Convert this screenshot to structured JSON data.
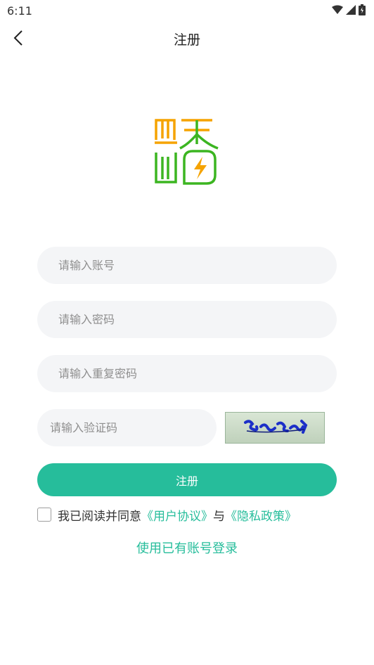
{
  "status_bar": {
    "time": "6:11",
    "icons": [
      "wifi-icon",
      "signal-icon",
      "battery-icon"
    ]
  },
  "header": {
    "title": "注册",
    "back_icon": "chevron-left-icon"
  },
  "logo": {
    "colors": {
      "orange": "#f5a300",
      "green": "#3cb521"
    }
  },
  "form": {
    "account_placeholder": "请输入账号",
    "password_placeholder": "请输入密码",
    "repeat_password_placeholder": "请输入重复密码",
    "code_placeholder": "请输入验证码",
    "submit_label": "注册"
  },
  "agreement": {
    "prefix": "我已阅读并同意",
    "user_agreement": "《用户协议》",
    "conjunction": "与",
    "privacy_policy": "《隐私政策》",
    "checked": false
  },
  "login_link": "使用已有账号登录",
  "colors": {
    "accent": "#26bd9b",
    "field_bg": "#f4f5f7",
    "placeholder": "#8f8f8f",
    "text": "#333333"
  }
}
